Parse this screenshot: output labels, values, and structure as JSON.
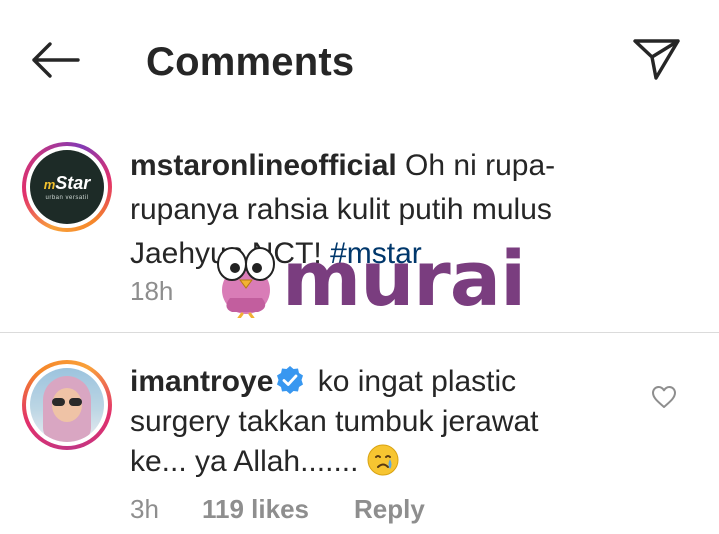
{
  "header": {
    "title": "Comments",
    "back_icon": "arrow-left-icon",
    "share_icon": "paper-plane-icon"
  },
  "caption": {
    "avatar_logo": "Star",
    "avatar_logo_prefix": "m",
    "avatar_tagline": "urban versatil",
    "username": "mstaronlineofficial",
    "text": " Oh ni rupa-rupanya rahsia kulit putih mulus Jaehyun NCT! ",
    "hashtag": "#mstar",
    "time": "18h"
  },
  "watermark": {
    "text": "murai"
  },
  "comment": {
    "username": "imantroye",
    "verified_icon": "verified-badge-icon",
    "text": " ko ingat plastic surgery takkan tumbuk jerawat ke... ya Allah.......",
    "emoji": "crying-face-emoji",
    "time": "3h",
    "likes": "119 likes",
    "reply_label": "Reply",
    "heart_icon": "heart-outline-icon"
  },
  "colors": {
    "text": "#262626",
    "muted": "#8e8e8e",
    "hashtag": "#00376b",
    "verified": "#3897f0",
    "watermark": "#7a3d7f",
    "divider": "#dbdbdb"
  }
}
